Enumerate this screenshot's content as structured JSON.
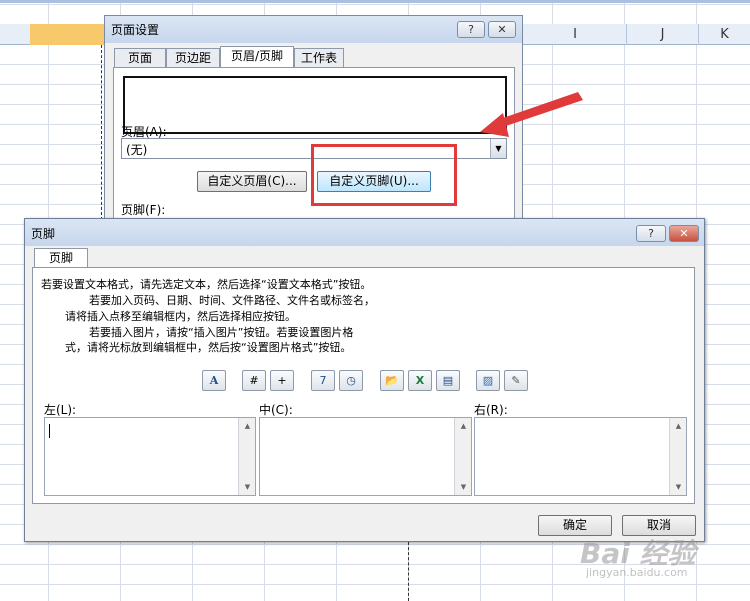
{
  "sheet": {
    "columns": [
      {
        "label": ""
      },
      {
        "label": "I"
      },
      {
        "label": "J"
      },
      {
        "label": "K"
      }
    ]
  },
  "page_setup_dialog": {
    "title": "页面设置",
    "help_button": "?",
    "close_button": "✕",
    "tabs": [
      {
        "label": "页面"
      },
      {
        "label": "页边距"
      },
      {
        "label": "页眉/页脚"
      },
      {
        "label": "工作表"
      }
    ],
    "header_label": "页眉(A):",
    "header_value": "(无)",
    "custom_header_button": "自定义页眉(C)...",
    "custom_footer_button": "自定义页脚(U)...",
    "footer_label": "页脚(F):"
  },
  "footer_dialog": {
    "title": "页脚",
    "help_button": "?",
    "close_button": "✕",
    "tab": "页脚",
    "instructions": [
      "若要设置文本格式，请先选定文本，然后选择“设置文本格式”按钮。",
      "若要加入页码、日期、时间、文件路径、文件名或标签名，",
      "请将插入点移至编辑框内，然后选择相应按钮。",
      "若要插入图片，请按“插入图片”按钮。若要设置图片格",
      "式，请将光标放到编辑框中，然后按“设置图片格式”按钮。"
    ],
    "toolbar": [
      {
        "name": "format-text",
        "glyph": "A"
      },
      {
        "name": "insert-page-number",
        "glyph": "#"
      },
      {
        "name": "insert-page-count",
        "glyph": "+"
      },
      {
        "name": "insert-date",
        "glyph": "7"
      },
      {
        "name": "insert-time",
        "glyph": "◷"
      },
      {
        "name": "insert-file-path",
        "glyph": "📂"
      },
      {
        "name": "insert-file-name",
        "glyph": "X"
      },
      {
        "name": "insert-sheet-name",
        "glyph": "▤"
      },
      {
        "name": "insert-picture",
        "glyph": "▨"
      },
      {
        "name": "format-picture",
        "glyph": "✎"
      }
    ],
    "sections": [
      {
        "label": "左(L):"
      },
      {
        "label": "中(C):"
      },
      {
        "label": "右(R):"
      }
    ],
    "ok_button": "确定",
    "cancel_button": "取消"
  },
  "watermark": {
    "text": "Bai 经验",
    "subtext": "jingyan.baidu.com"
  },
  "colors": {
    "highlight": "#e03a3a",
    "title_bar": "#c6d6ec",
    "selected_column": "#f7c96a"
  }
}
